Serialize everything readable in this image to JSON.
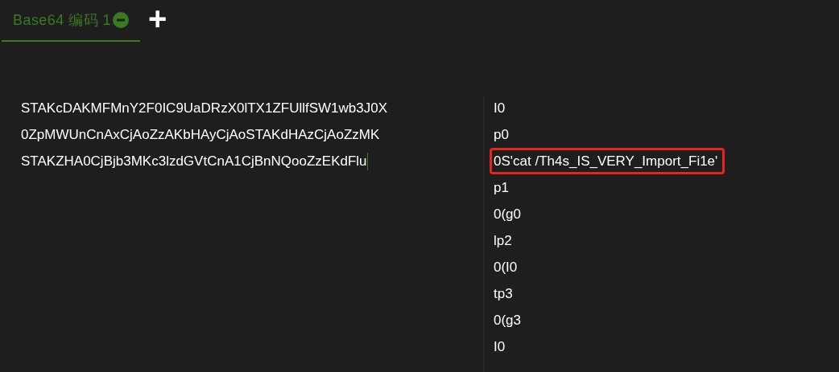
{
  "tabs": [
    {
      "label": "Base64 编码 1",
      "selected": true
    }
  ],
  "add_tab": "+",
  "input": {
    "lines": [
      "STAKcDAKMFMnY2F0IC9UaDRzX0lTX1ZFUllfSW1wb3J0X",
      "0ZpMWUnCnAxCjAoZzAKbHAyCjAoSTAKdHAzCjAoZzMK",
      "STAKZHA0CjBjb3MKc3lzdGVtCnA1CjBnNQooZzEKdFlu"
    ]
  },
  "output": {
    "lines": [
      {
        "text": "I0",
        "highlighted": false
      },
      {
        "text": "p0",
        "highlighted": false
      },
      {
        "text": "0S'cat /Th4s_IS_VERY_Import_Fi1e'",
        "highlighted": true
      },
      {
        "text": "p1",
        "highlighted": false
      },
      {
        "text": "0(g0",
        "highlighted": false
      },
      {
        "text": "lp2",
        "highlighted": false
      },
      {
        "text": "0(I0",
        "highlighted": false
      },
      {
        "text": "tp3",
        "highlighted": false
      },
      {
        "text": "0(g3",
        "highlighted": false
      },
      {
        "text": "I0",
        "highlighted": false
      }
    ]
  }
}
